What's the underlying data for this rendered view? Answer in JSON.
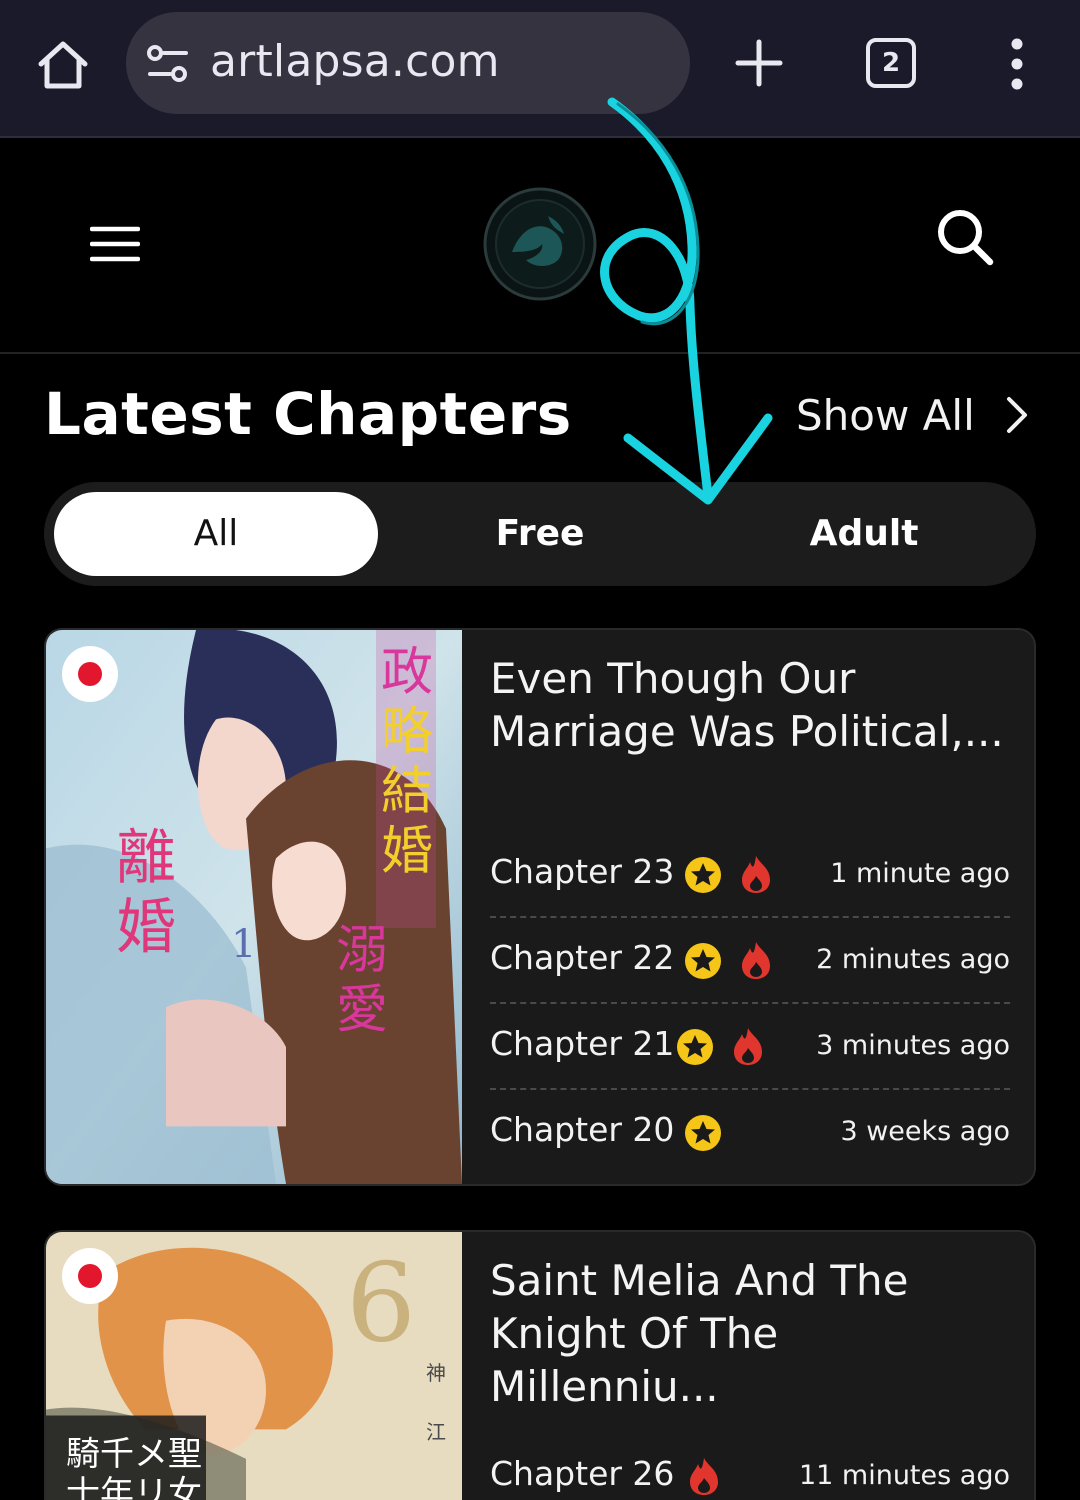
{
  "browser": {
    "url": "artlapsa.com",
    "tab_count": "2",
    "icons": [
      "home-icon",
      "site-settings-icon",
      "new-tab-icon",
      "tab-switcher-icon",
      "more-menu-icon"
    ]
  },
  "site": {
    "icons": [
      "hamburger-menu-icon",
      "site-logo",
      "search-icon"
    ]
  },
  "section": {
    "title": "Latest Chapters",
    "show_all": "Show All"
  },
  "filters": [
    {
      "label": "All",
      "active": true
    },
    {
      "label": "Free",
      "active": false
    },
    {
      "label": "Adult",
      "active": false
    }
  ],
  "cards": [
    {
      "title": "Even Though Our Marriage Was Political,...",
      "chapters": [
        {
          "name": "Chapter 23",
          "premium": true,
          "hot": true,
          "time": "1 minute ago"
        },
        {
          "name": "Chapter 22",
          "premium": true,
          "hot": true,
          "time": "2 minutes ago"
        },
        {
          "name": "Chapter 21",
          "premium": true,
          "hot": true,
          "time": "3 minutes ago"
        },
        {
          "name": "Chapter 20",
          "premium": true,
          "hot": false,
          "time": "3 weeks ago"
        }
      ]
    },
    {
      "title": "Saint Melia And The Knight Of The Millenniu...",
      "chapters": [
        {
          "name": "Chapter 26",
          "premium": false,
          "hot": true,
          "time": "11 minutes ago"
        }
      ]
    }
  ],
  "colors": {
    "chrome_bg": "#1b1a2a",
    "urlbar_bg": "#35333f",
    "page_bg": "#000000",
    "card_bg": "#1a1a1a",
    "star": "#f5c518",
    "fire": "#e0362e",
    "annotation": "#19d3e0"
  }
}
